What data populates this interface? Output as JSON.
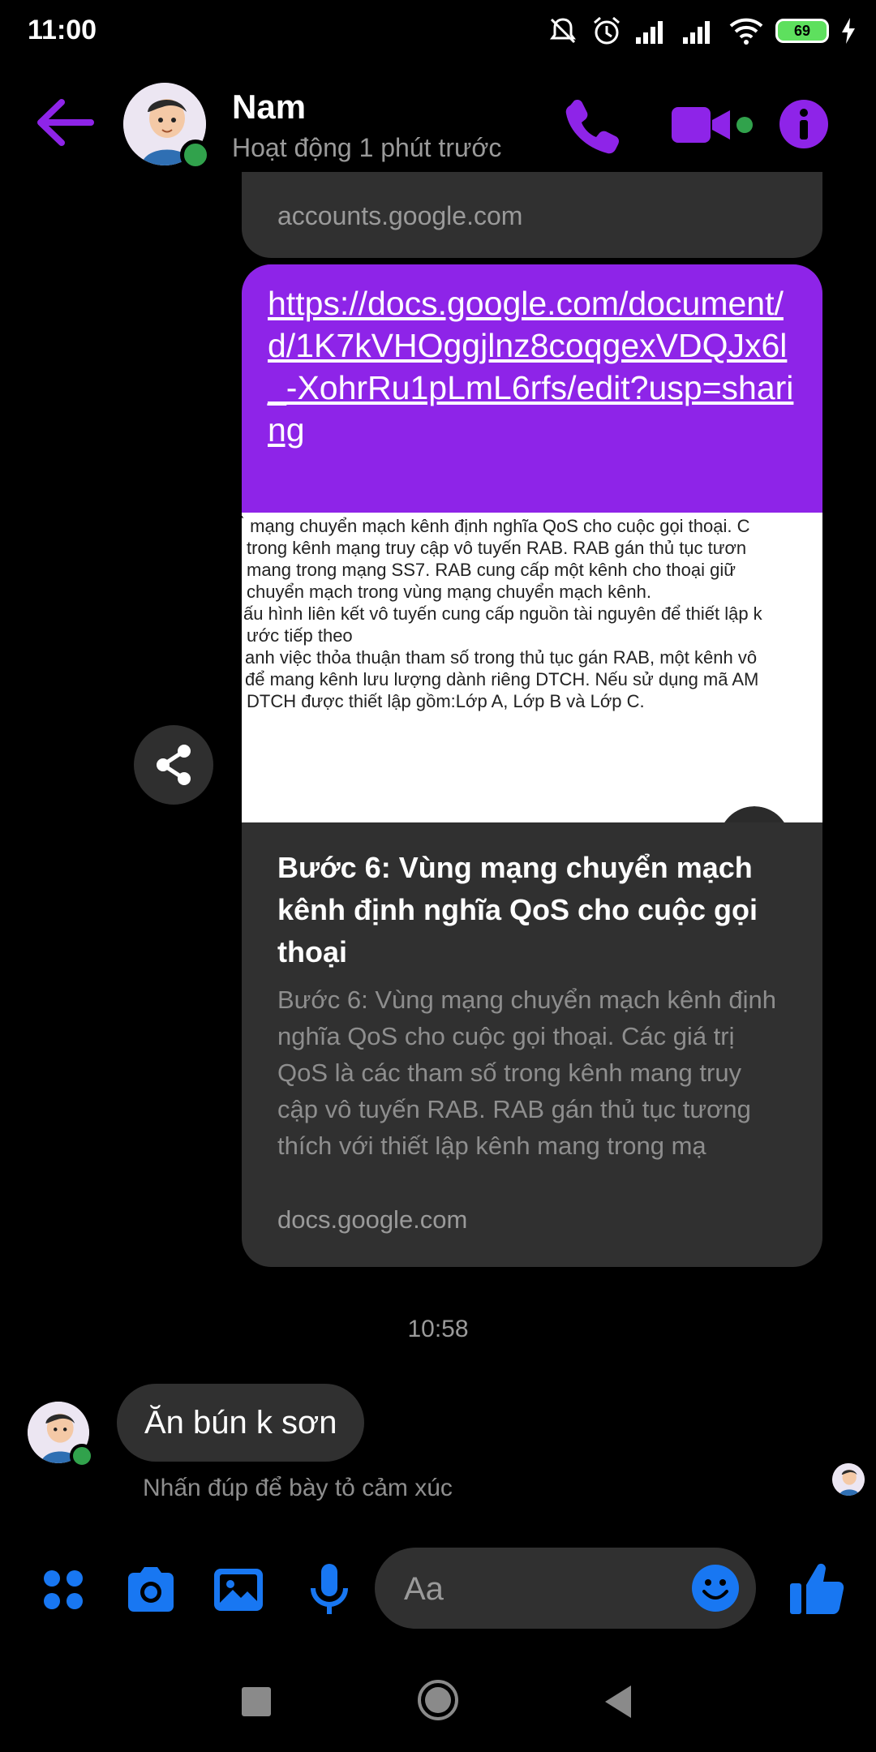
{
  "status_bar": {
    "time": "11:00",
    "battery": "69"
  },
  "header": {
    "contact_name": "Nam",
    "contact_status": "Hoạt động 1 phút trước"
  },
  "previous_card": {
    "domain": "accounts.google.com"
  },
  "link_message": {
    "url": "https://docs.google.com/document/d/1K7kVHOggjlnz8coqgexVDQJx6l_-XohrRu1pLmL6rfs/edit?usp=sharing",
    "preview_lines": [
      "̀ mạng chuyển mạch kênh định nghĩa QoS cho cuộc gọi thoại. C",
      "trong kênh mạng truy cập vô tuyến RAB. RAB gán thủ tục tươn",
      "mang trong mạng SS7. RAB cung cấp một kênh cho thoại giữ",
      "chuyển mạch trong vùng mạng chuyển mạch kênh.",
      "ấu hình liên kết vô tuyến cung cấp nguồn tài nguyên để thiết lập k",
      "ước tiếp theo",
      "anh việc thỏa thuận tham số trong thủ tục gán RAB, một kênh vô",
      "để mang kênh lưu lượng dành riêng DTCH. Nếu sử dụng mã AM",
      "DTCH được thiết lập gồm:Lớp A, Lớp B và Lớp C."
    ],
    "title": "Bước 6: Vùng mạng chuyển mạch kênh định nghĩa QoS cho cuộc gọi thoại",
    "description": "Bước 6: Vùng mạng chuyển mạch kênh định nghĩa QoS cho cuộc gọi thoại. Các giá trị QoS là các tham số trong kênh mang truy cập vô tuyến RAB. RAB gán thủ tục tương thích với thiết lập kênh mang trong mạ",
    "domain": "docs.google.com"
  },
  "timestamp": "10:58",
  "incoming_message": {
    "text": "Ăn bún k sơn",
    "reaction_hint": "Nhấn đúp để bày tỏ cảm xúc"
  },
  "composer": {
    "placeholder": "Aa"
  },
  "colors": {
    "accent_purple": "#8e24e8",
    "messenger_blue": "#1877f2",
    "online_green": "#31a24c",
    "bubble_dark": "#303030"
  },
  "icons": {
    "header": [
      "back-arrow-icon",
      "phone-icon",
      "video-camera-icon",
      "info-icon"
    ],
    "composer": [
      "apps-grid-icon",
      "camera-icon",
      "image-icon",
      "microphone-icon",
      "emoji-icon",
      "thumbs-up-icon"
    ]
  }
}
